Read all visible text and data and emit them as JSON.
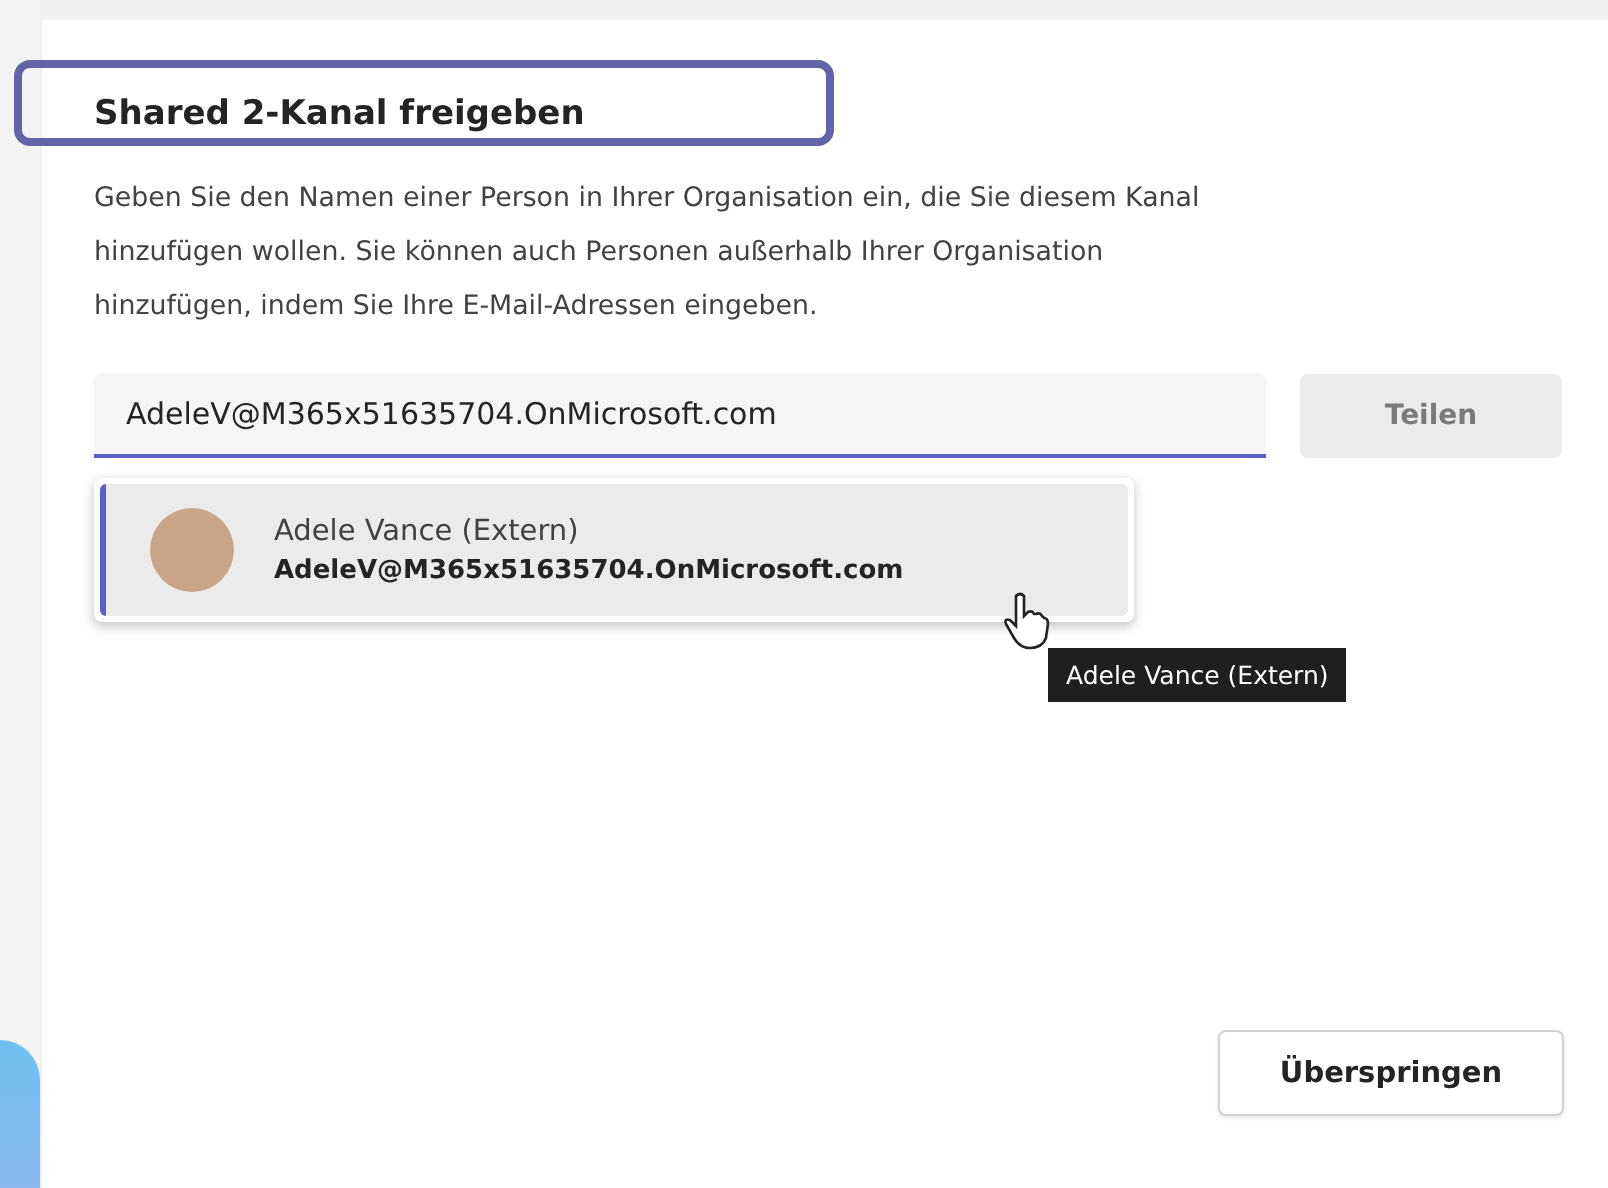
{
  "dialog": {
    "title": "Shared 2-Kanal freigeben",
    "title_highlighted": true,
    "description": "Geben Sie den Namen einer Person in Ihrer Organisation ein, die Sie diesem Kanal hinzufügen wollen. Sie können auch Personen außerhalb Ihrer Organisation hinzufügen, indem Sie Ihre E-Mail-Adressen eingeben.",
    "field": {
      "value": "AdeleV@M365x51635704.OnMicrosoft.com"
    },
    "share_button": {
      "label": "Teilen",
      "disabled": true
    },
    "suggestions": [
      {
        "name": "Adele Vance (Extern)",
        "email": "AdeleV@M365x51635704.OnMicrosoft.com",
        "selected": true
      }
    ],
    "tooltip": "Adele Vance (Extern)",
    "skip_button": {
      "label": "Überspringen"
    }
  }
}
